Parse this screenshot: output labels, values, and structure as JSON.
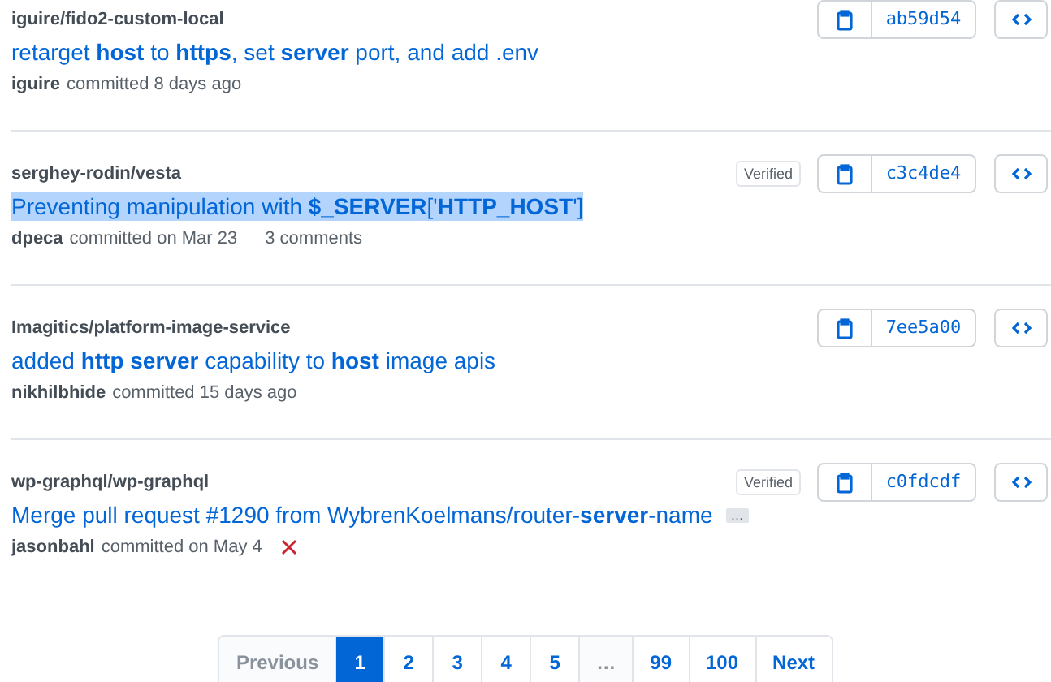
{
  "commits": [
    {
      "repo": "iguire/fido2-custom-local",
      "title": "retarget **host** to **https**, set **server** port, and add .env",
      "highlighted": false,
      "author": "iguire",
      "date": "committed 8 days ago",
      "verified": false,
      "sha": "ab59d54"
    },
    {
      "repo": "serghey-rodin/vesta",
      "title": "Preventing manipulation with **$_SERVER**['**HTTP_HOST**']",
      "highlighted": true,
      "author": "dpeca",
      "date": "committed on Mar 23",
      "comments": "3 comments",
      "verified": true,
      "verified_label": "Verified",
      "sha": "c3c4de4"
    },
    {
      "repo": "Imagitics/platform-image-service",
      "title": "added **http server** capability to **host** image apis",
      "highlighted": false,
      "author": "nikhilbhide",
      "date": "committed 15 days ago",
      "verified": false,
      "sha": "7ee5a00"
    },
    {
      "repo": "wp-graphql/wp-graphql",
      "title": "Merge pull request #1290 from WybrenKoelmans/router-**server**-name",
      "highlighted": false,
      "expander": "…",
      "author": "jasonbahl",
      "date": "committed on May 4",
      "failed": true,
      "verified": true,
      "verified_label": "Verified",
      "sha": "c0fdcdf"
    }
  ],
  "pagination": [
    {
      "label": "Previous",
      "selected": false,
      "disabled": true
    },
    {
      "label": "1",
      "selected": true,
      "disabled": false
    },
    {
      "label": "2",
      "selected": false,
      "disabled": false
    },
    {
      "label": "3",
      "selected": false,
      "disabled": false
    },
    {
      "label": "4",
      "selected": false,
      "disabled": false
    },
    {
      "label": "5",
      "selected": false,
      "disabled": false
    },
    {
      "label": "…",
      "selected": false,
      "disabled": true
    },
    {
      "label": "99",
      "selected": false,
      "disabled": false
    },
    {
      "label": "100",
      "selected": false,
      "disabled": false
    },
    {
      "label": "Next",
      "selected": false,
      "disabled": false
    }
  ]
}
